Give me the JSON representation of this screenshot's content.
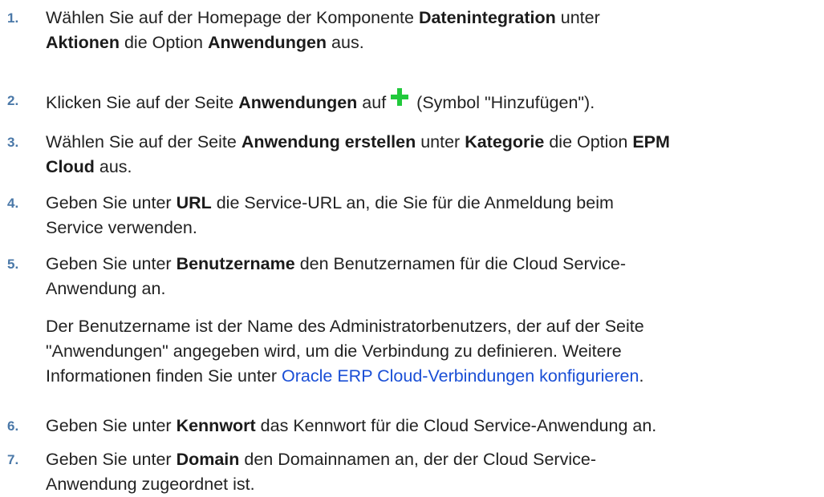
{
  "steps": [
    {
      "number": "1.",
      "parts": [
        "Wählen Sie auf der Homepage der Komponente ",
        "Datenintegration",
        " unter",
        "Aktionen",
        " die Option ",
        "Anwendungen",
        " aus."
      ]
    },
    {
      "number": "2.",
      "parts": [
        "Klicken Sie auf der Seite ",
        "Anwendungen",
        " auf",
        " (Symbol \"Hinzufügen\")."
      ],
      "icon": "plus-icon"
    },
    {
      "number": "3.",
      "parts": [
        "Wählen Sie auf der Seite ",
        "Anwendung erstellen",
        " unter ",
        "Kategorie",
        " die Option ",
        "EPM",
        "Cloud",
        " aus."
      ]
    },
    {
      "number": "4.",
      "parts": [
        "Geben Sie unter ",
        "URL",
        " die Service-URL an, die Sie für die Anmeldung beim",
        "Service verwenden."
      ]
    },
    {
      "number": "5.",
      "parts": [
        "Geben Sie unter ",
        "Benutzername",
        " den Benutzernamen für die Cloud Service-",
        "Anwendung an."
      ],
      "note_lines": [
        "Der Benutzername ist der Name des Administratorbenutzers, der auf der Seite",
        "\"Anwendungen\" angegeben wird, um die Verbindung zu definieren. Weitere",
        "Informationen finden Sie unter "
      ],
      "link": "Oracle ERP Cloud-Verbindungen konfigurieren",
      "note_end": "."
    },
    {
      "number": "6.",
      "parts": [
        "Geben Sie unter ",
        "Kennwort",
        " das Kennwort für die Cloud Service-Anwendung an."
      ]
    },
    {
      "number": "7.",
      "parts": [
        "Geben Sie unter ",
        "Domain",
        " den Domainnamen an, der der Cloud Service-",
        "Anwendung zugeordnet ist."
      ]
    }
  ],
  "colors": {
    "number": "#4a78a8",
    "link": "#1a4fd6",
    "plus_icon": "#21c93c"
  }
}
